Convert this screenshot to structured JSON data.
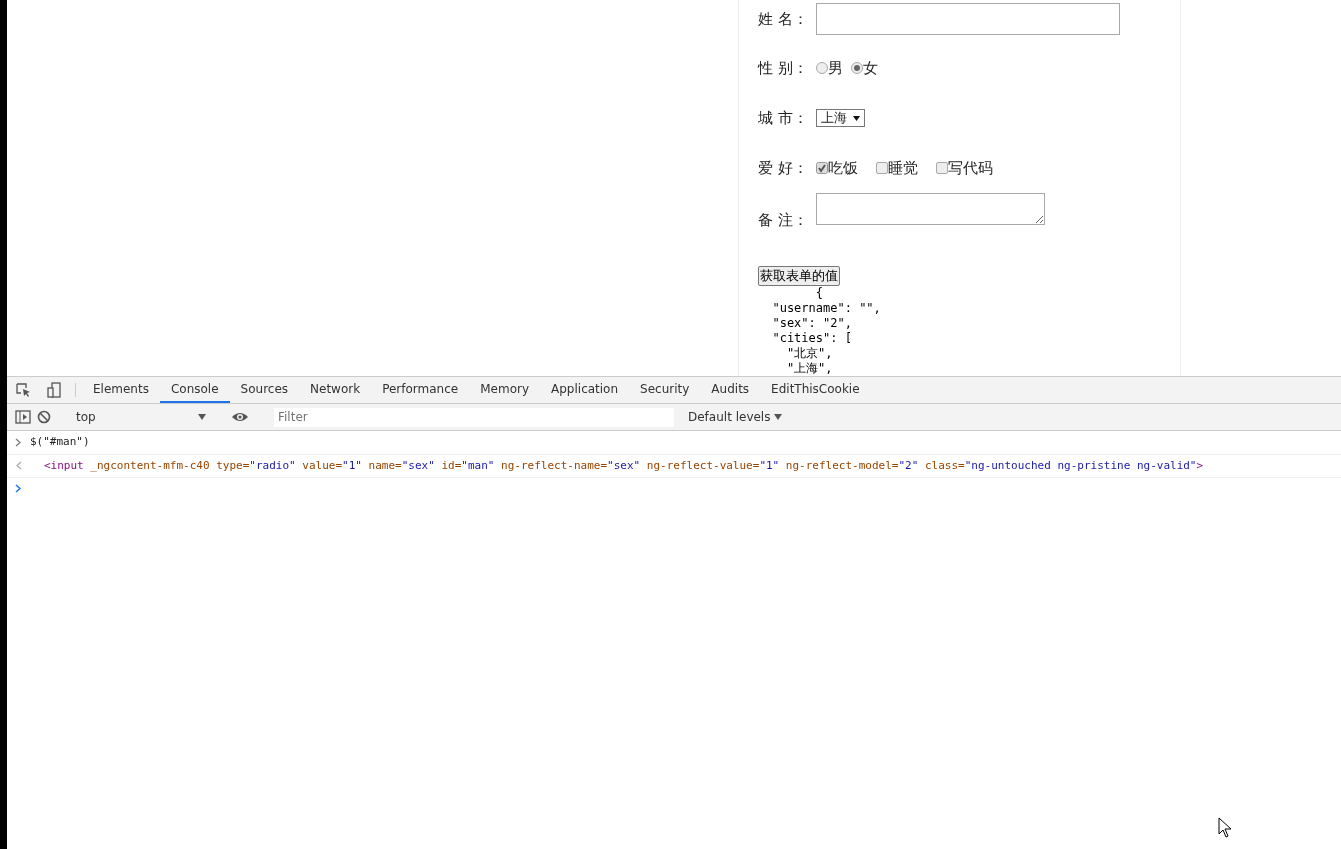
{
  "form": {
    "rows": [
      {
        "kind": "text",
        "label": "姓 名：",
        "value": ""
      },
      {
        "kind": "radio",
        "label": "性 别：",
        "options": [
          {
            "text": "男",
            "selected": false
          },
          {
            "text": "女",
            "selected": true
          }
        ]
      },
      {
        "kind": "select",
        "label": "城 市：",
        "value": "上海"
      },
      {
        "kind": "checkbox",
        "label": "爱 好：",
        "options": [
          {
            "text": "吃饭",
            "checked": true
          },
          {
            "text": "睡觉",
            "checked": false
          },
          {
            "text": "写代码",
            "checked": false
          }
        ]
      },
      {
        "kind": "textarea",
        "label": "备 注：",
        "value": ""
      }
    ],
    "button": "获取表单的值",
    "output": [
      "        {",
      "  \"username\": \"\",",
      "  \"sex\": \"2\",",
      "  \"cities\": [",
      "    \"北京\",",
      "    \"上海\","
    ]
  },
  "devtools": {
    "tabs": [
      {
        "label": "Elements",
        "selected": false
      },
      {
        "label": "Console",
        "selected": true
      },
      {
        "label": "Sources",
        "selected": false
      },
      {
        "label": "Network",
        "selected": false
      },
      {
        "label": "Performance",
        "selected": false
      },
      {
        "label": "Memory",
        "selected": false
      },
      {
        "label": "Application",
        "selected": false
      },
      {
        "label": "Security",
        "selected": false
      },
      {
        "label": "Audits",
        "selected": false
      },
      {
        "label": "EditThisCookie",
        "selected": false
      }
    ],
    "context": "top",
    "filter_placeholder": "Filter",
    "levels": "Default levels",
    "console": [
      {
        "kind": "input",
        "parts": [
          {
            "kind": "plain",
            "text": "$(\"#man\")"
          }
        ]
      },
      {
        "kind": "output",
        "parts": [
          {
            "kind": "tag",
            "text": "<input"
          },
          {
            "kind": "attr",
            "text": " _ngcontent-mfm-c40"
          },
          {
            "kind": "attr",
            "text": " type="
          },
          {
            "kind": "value",
            "text": "\"radio\""
          },
          {
            "kind": "attr",
            "text": " value="
          },
          {
            "kind": "value",
            "text": "\"1\""
          },
          {
            "kind": "attr",
            "text": " name="
          },
          {
            "kind": "value",
            "text": "\"sex\""
          },
          {
            "kind": "attr",
            "text": " id="
          },
          {
            "kind": "value",
            "text": "\"man\""
          },
          {
            "kind": "attr",
            "text": " ng-reflect-name="
          },
          {
            "kind": "value",
            "text": "\"sex\""
          },
          {
            "kind": "attr",
            "text": " ng-reflect-value="
          },
          {
            "kind": "value",
            "text": "\"1\""
          },
          {
            "kind": "attr",
            "text": " ng-reflect-model="
          },
          {
            "kind": "value",
            "text": "\"2\""
          },
          {
            "kind": "attr",
            "text": " class="
          },
          {
            "kind": "value",
            "text": "\"ng-untouched ng-pristine ng-valid\""
          },
          {
            "kind": "tag",
            "text": ">"
          }
        ]
      }
    ]
  }
}
